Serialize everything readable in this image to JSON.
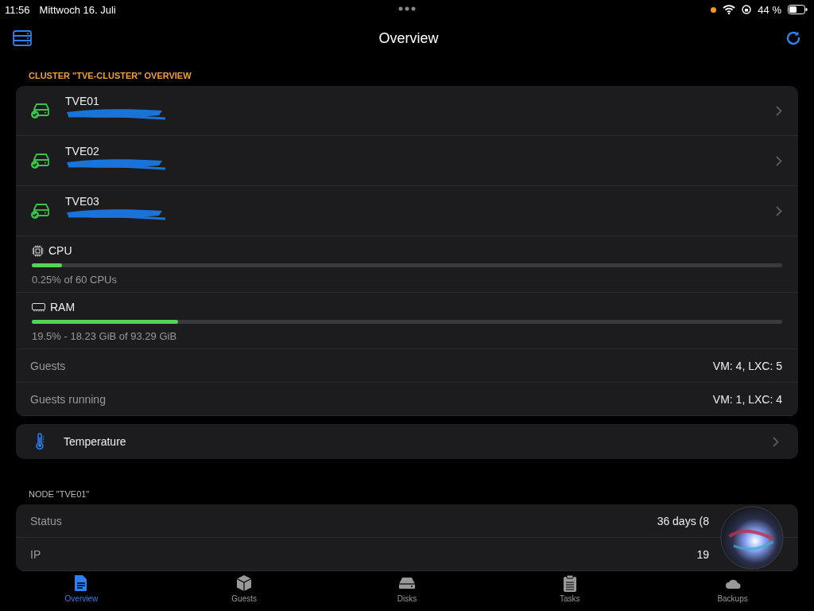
{
  "status_bar": {
    "time": "11:56",
    "date": "Mittwoch 16. Juli",
    "battery": "44 %"
  },
  "nav": {
    "title": "Overview"
  },
  "cluster": {
    "header": "CLUSTER \"TVE-CLUSTER\" OVERVIEW",
    "nodes": [
      {
        "name": "TVE01",
        "online": true
      },
      {
        "name": "TVE02",
        "online": true
      },
      {
        "name": "TVE03",
        "online": true
      }
    ],
    "meters": [
      {
        "kind": "cpu",
        "label": "CPU",
        "level": 0.04,
        "reading": "0.25% of 60 CPUs"
      },
      {
        "kind": "ram",
        "label": "RAM",
        "level": 0.195,
        "reading": "19.5% - 18.23 GiB of 93.29 GiB"
      }
    ],
    "stats": [
      {
        "label": "Guests",
        "value": "VM: 4, LXC: 5"
      },
      {
        "label": "Guests running",
        "value": "VM: 1, LXC: 4"
      }
    ]
  },
  "temperature": {
    "label": "Temperature"
  },
  "node": {
    "header": "NODE \"TVE01\"",
    "rows": [
      {
        "label": "Status",
        "value": "36 days (8"
      },
      {
        "label": "IP",
        "value": "19"
      }
    ]
  },
  "tabs": [
    {
      "label": "Overview",
      "kind": "doc",
      "selected": true
    },
    {
      "label": "Guests",
      "kind": "cube",
      "selected": false
    },
    {
      "label": "Disks",
      "kind": "disk",
      "selected": false
    },
    {
      "label": "Tasks",
      "kind": "clipboard",
      "selected": false
    },
    {
      "label": "Backups",
      "kind": "backup",
      "selected": false
    }
  ]
}
